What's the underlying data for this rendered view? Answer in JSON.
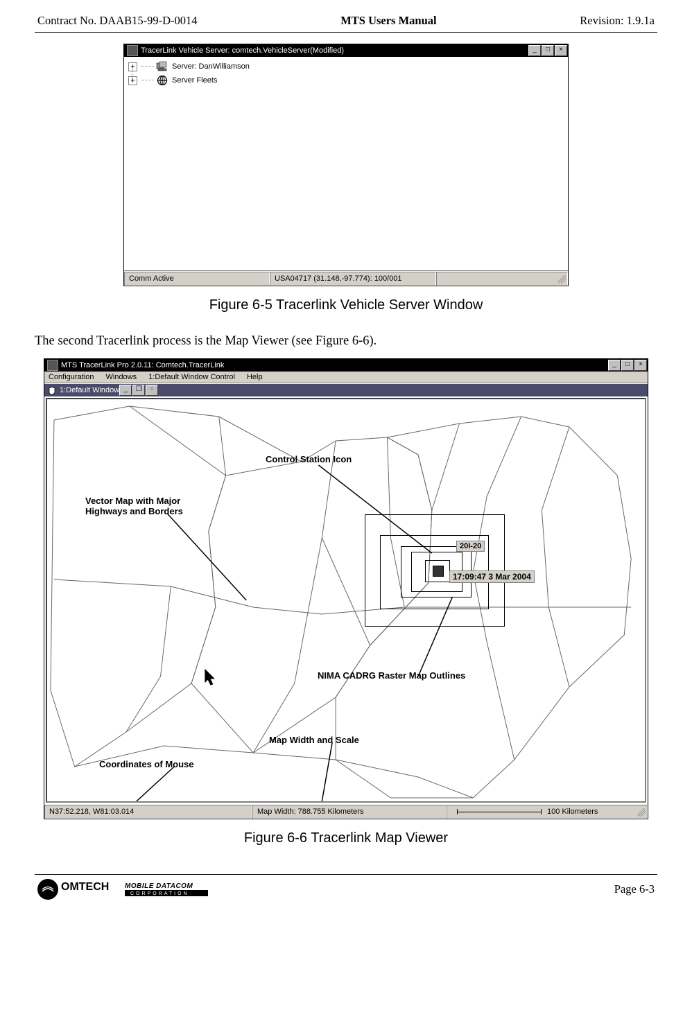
{
  "header": {
    "contract": "Contract No. DAAB15-99-D-0014",
    "title": "MTS Users Manual",
    "revision": "Revision:  1.9.1a"
  },
  "figure1": {
    "window_title": "TracerLink Vehicle Server:  comtech.VehicleServer(Modified)",
    "tree": {
      "node1": "Server: DanWilliamson",
      "node2": "Server Fleets"
    },
    "status": {
      "comm": "Comm Active",
      "coords": "USA04717 (31.148,-97.774): 100/001"
    },
    "caption": "Figure 6-5     Tracerlink Vehicle Server Window"
  },
  "body_line": "The second Tracerlink process is the Map Viewer (see Figure 6-6).",
  "figure2": {
    "window_title": "MTS TracerLink Pro 2.0.11: Comtech.TracerLink",
    "menu": {
      "m1": "Configuration",
      "m2": "Windows",
      "m3": "1:Default Window Control",
      "m4": "Help"
    },
    "inner_title": "1:Default Window",
    "legends": {
      "control_station": "Control Station Icon",
      "vector_map_l1": "Vector Map with Major",
      "vector_map_l2": "Highways and Borders",
      "raster": "NIMA CADRG Raster Map Outlines",
      "map_width": "Map Width and Scale",
      "coords": "Coordinates of Mouse"
    },
    "unit_id": "20I-20",
    "timestamp": "17:09:47 3 Mar 2004",
    "status": {
      "coords": "N37:52.218, W81:03.014",
      "map_width": "Map Width: 788.755 Kilometers",
      "scale_label": "100 Kilometers"
    },
    "caption": "Figure 6-6     Tracerlink Map Viewer"
  },
  "footer": {
    "logo_brand": "OMTECH",
    "logo_sub1": "MOBILE DATACOM",
    "logo_sub2": "CORPORATION",
    "page": "Page 6-3"
  }
}
